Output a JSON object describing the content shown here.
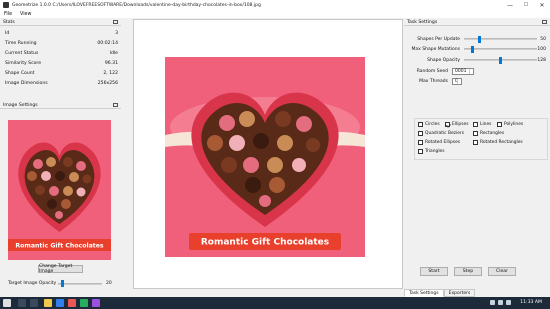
{
  "window": {
    "title": "Geometrize 1.0.0 C:/Users/ILOVEFREESOFTWARE/Downloads/valentine-day-birthday-chocolates-in-box/108.jpg",
    "controls": {
      "minimize": "—",
      "maximize": "☐",
      "close": "✕"
    }
  },
  "menu": {
    "items": [
      "File",
      "View"
    ]
  },
  "stats": {
    "title": "Stats",
    "rows": [
      {
        "label": "Id",
        "value": "3"
      },
      {
        "label": "Time Running",
        "value": "00:02:14"
      },
      {
        "label": "Current Status",
        "value": "Idle"
      },
      {
        "label": "Similarity Score",
        "value": "96.31"
      },
      {
        "label": "Shape Count",
        "value": "2, 122"
      },
      {
        "label": "Image Dimensions",
        "value": "256x256"
      }
    ]
  },
  "image_settings": {
    "title": "Image Settings",
    "preview_banner": "Romantic Gift Chocolates",
    "change_button": "Change Target Image",
    "opacity_label": "Target Image Opacity",
    "opacity_value": "20",
    "opacity_level": 0.08
  },
  "canvas": {
    "banner_text": "Romantic Gift Chocolates"
  },
  "task_settings": {
    "title": "Task Settings",
    "sliders": [
      {
        "label": "Shapes Per Update",
        "value": "50",
        "level": 0.2
      },
      {
        "label": "Max Shape Mutations",
        "value": "100",
        "level": 0.1
      },
      {
        "label": "Shape Opacity",
        "value": "128",
        "level": 0.5
      }
    ],
    "random_seed": {
      "label": "Random Seed",
      "value": "0001"
    },
    "max_threads": {
      "label": "Max Threads",
      "value": "0"
    },
    "shapes": {
      "circles": {
        "label": "Circles",
        "checked": false
      },
      "ellipses": {
        "label": "Ellipses",
        "checked": true
      },
      "lines": {
        "label": "Lines",
        "checked": false
      },
      "polylines": {
        "label": "Polylines",
        "checked": false
      },
      "quadratic_beziers": {
        "label": "Quadratic Beziers",
        "checked": false
      },
      "rectangles": {
        "label": "Rectangles",
        "checked": false
      },
      "rotated_ellipses": {
        "label": "Rotated Ellipses",
        "checked": false
      },
      "rotated_rectangles": {
        "label": "Rotated Rectangles",
        "checked": false
      },
      "triangles": {
        "label": "Triangles",
        "checked": false
      }
    },
    "buttons": {
      "start": "Start",
      "step": "Step",
      "clear": "Clear"
    }
  },
  "tabs": [
    {
      "label": "Task Settings",
      "active": true
    },
    {
      "label": "Exporters",
      "active": false
    }
  ],
  "taskbar": {
    "time": "11:33 AM"
  },
  "colors": {
    "accent": "#0078d7",
    "pink_bg": "#f0607a",
    "box_red": "#d8344a",
    "chocolate": "#5a2a18",
    "ribbon": "#e8402c",
    "taskbar": "#1c2a3a"
  }
}
